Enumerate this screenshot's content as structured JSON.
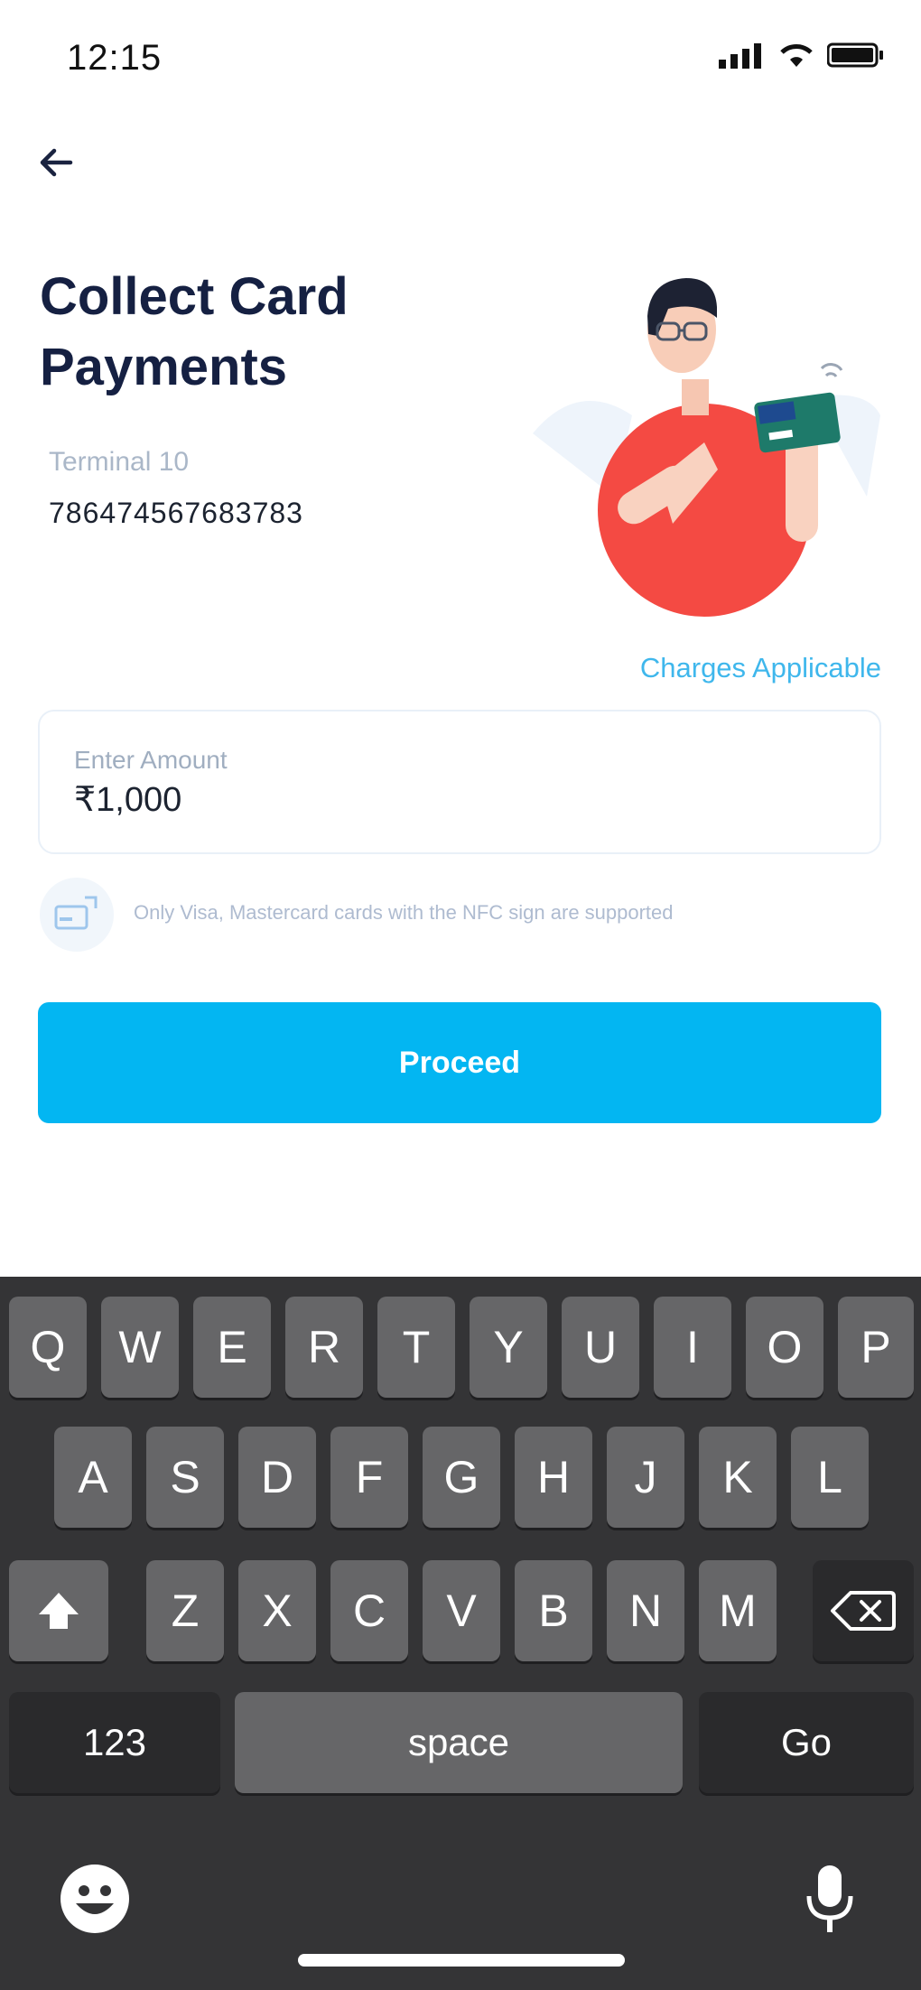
{
  "status_bar": {
    "time": "12:15"
  },
  "header": {
    "title_line1": "Collect Card",
    "title_line2": "Payments"
  },
  "terminal": {
    "label": "Terminal 10",
    "number": "786474567683783"
  },
  "charges_link": "Charges Applicable",
  "amount_field": {
    "label": "Enter Amount",
    "value": "₹1,000"
  },
  "nfc_note": "Only Visa, Mastercard cards with the NFC sign are supported",
  "proceed_label": "Proceed",
  "keyboard": {
    "row1": [
      "Q",
      "W",
      "E",
      "R",
      "T",
      "Y",
      "U",
      "I",
      "O",
      "P"
    ],
    "row2": [
      "A",
      "S",
      "D",
      "F",
      "G",
      "H",
      "J",
      "K",
      "L"
    ],
    "row3": [
      "Z",
      "X",
      "C",
      "V",
      "B",
      "N",
      "M"
    ],
    "numbers_label": "123",
    "space_label": "space",
    "go_label": "Go"
  },
  "colors": {
    "accent": "#03b6f2",
    "title": "#152042",
    "keyboard_bg": "#343436",
    "key_bg": "#666668"
  }
}
